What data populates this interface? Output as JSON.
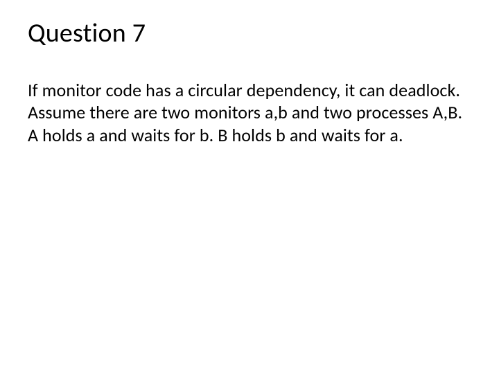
{
  "slide": {
    "title": "Question 7",
    "body_lines": [
      "If monitor code has a circular dependency, it can deadlock.",
      "Assume there are two monitors a,b and two processes A,B.  A holds a and waits for b. B holds b and waits for a."
    ]
  }
}
